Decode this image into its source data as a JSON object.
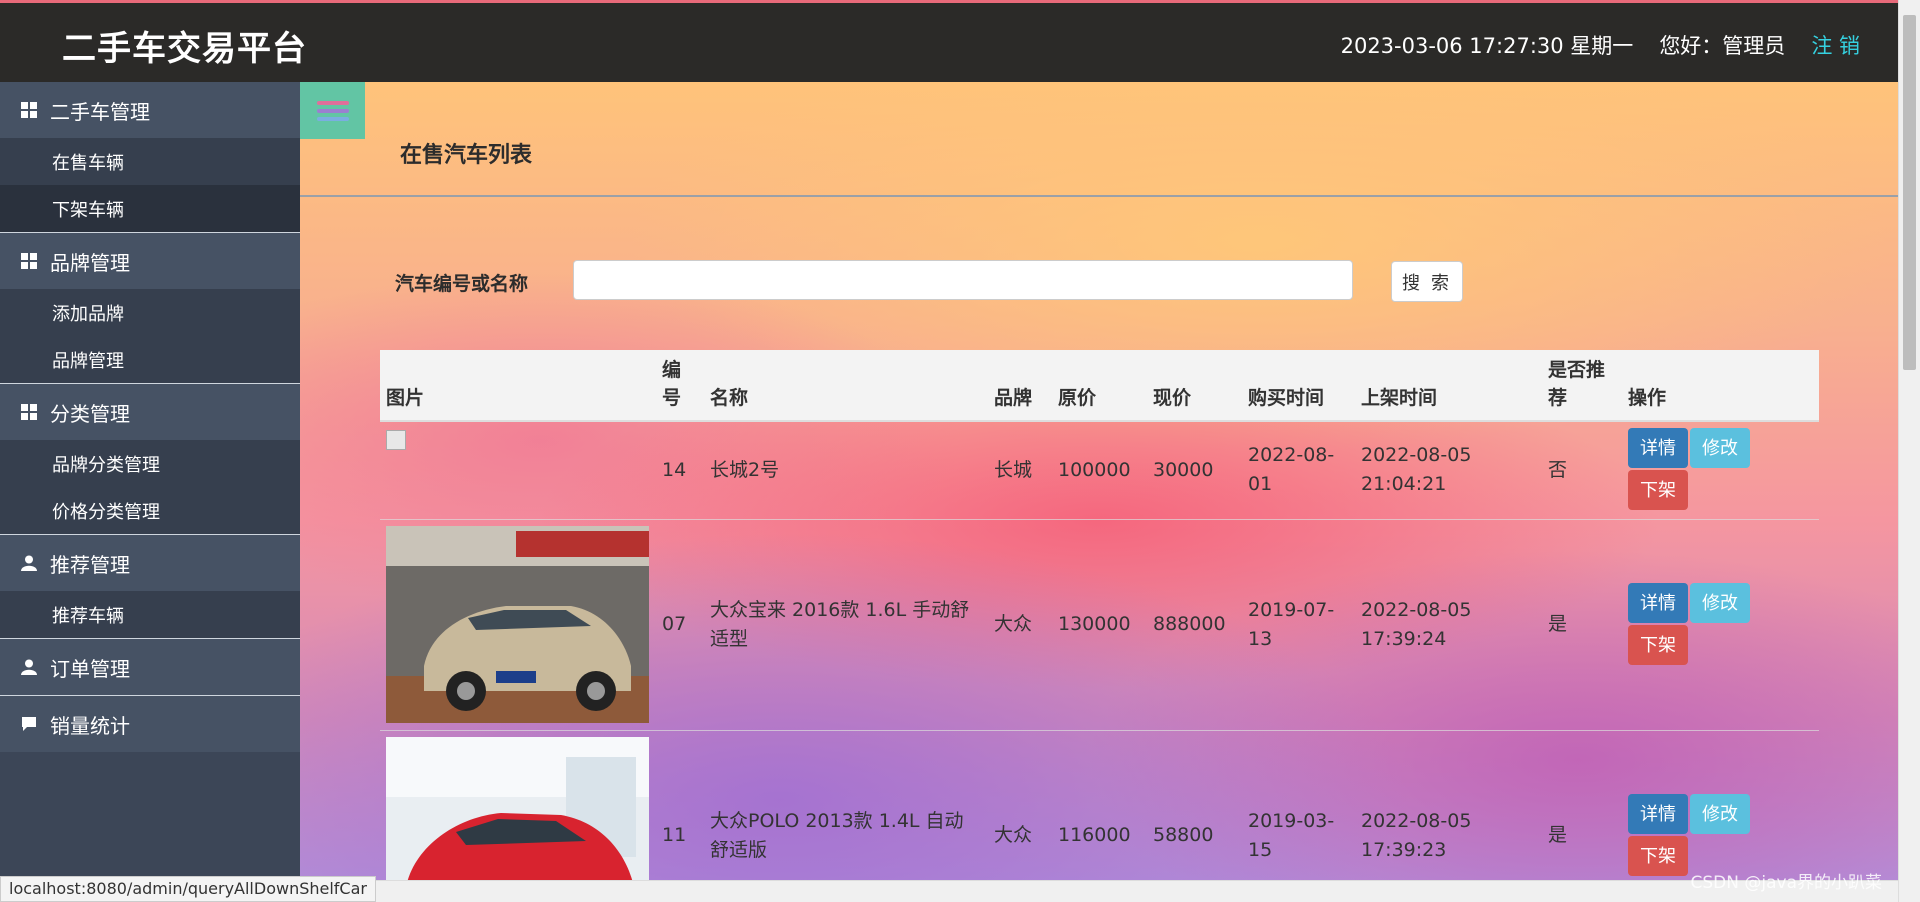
{
  "header": {
    "brand": "二手车交易平台",
    "datetime": "2023-03-06 17:27:30 星期一",
    "greeting": "您好：管理员",
    "logout": "注 销"
  },
  "sidebar": {
    "groups": [
      {
        "title": "二手车管理",
        "icon": "grid-icon",
        "items": [
          "在售车辆",
          "下架车辆"
        ]
      },
      {
        "title": "品牌管理",
        "icon": "grid-icon",
        "items": [
          "添加品牌",
          "品牌管理"
        ]
      },
      {
        "title": "分类管理",
        "icon": "grid-icon",
        "items": [
          "品牌分类管理",
          "价格分类管理"
        ]
      },
      {
        "title": "推荐管理",
        "icon": "user-icon",
        "items": [
          "推荐车辆"
        ]
      },
      {
        "title": "订单管理",
        "icon": "user-icon",
        "items": []
      },
      {
        "title": "销量统计",
        "icon": "comment-icon",
        "items": []
      }
    ]
  },
  "main": {
    "page_title": "在售汽车列表",
    "search": {
      "label": "汽车编号或名称",
      "placeholder": "",
      "value": "",
      "button": "搜 索"
    },
    "table": {
      "headers": {
        "image": "图片",
        "id": "编号",
        "name": "名称",
        "brand": "品牌",
        "orig_price": "原价",
        "cur_price": "现价",
        "buy_date": "购买时间",
        "shelf_time": "上架时间",
        "recommend": "是否推荐",
        "ops": "操作"
      },
      "rows": [
        {
          "id": "14",
          "name": "长城2号",
          "brand": "长城",
          "orig_price": "100000",
          "cur_price": "30000",
          "buy_date": "2022-08-01",
          "shelf_time": "2022-08-05 21:04:21",
          "recommend": "否"
        },
        {
          "id": "07",
          "name": "大众宝来 2016款 1.6L 手动舒适型",
          "brand": "大众",
          "orig_price": "130000",
          "cur_price": "888000",
          "buy_date": "2019-07-13",
          "shelf_time": "2022-08-05 17:39:24",
          "recommend": "是"
        },
        {
          "id": "11",
          "name": "大众POLO 2013款 1.4L 自动舒适版",
          "brand": "大众",
          "orig_price": "116000",
          "cur_price": "58800",
          "buy_date": "2019-03-15",
          "shelf_time": "2022-08-05 17:39:23",
          "recommend": "是"
        }
      ],
      "buttons": {
        "detail": "详情",
        "edit": "修改",
        "offshelf": "下架"
      }
    }
  },
  "status_url": "localhost:8080/admin/queryAllDownShelfCar",
  "watermark": "CSDN @java界的小趴菜",
  "colors": {
    "header_bg": "#2b2a28",
    "sidebar_bg": "#3c4657",
    "accent_logout": "#35d1e0",
    "btn_blue": "#337ab7",
    "btn_cyan": "#5bc0de",
    "btn_red": "#d9534f",
    "toggle_bg": "#62c5a4"
  }
}
